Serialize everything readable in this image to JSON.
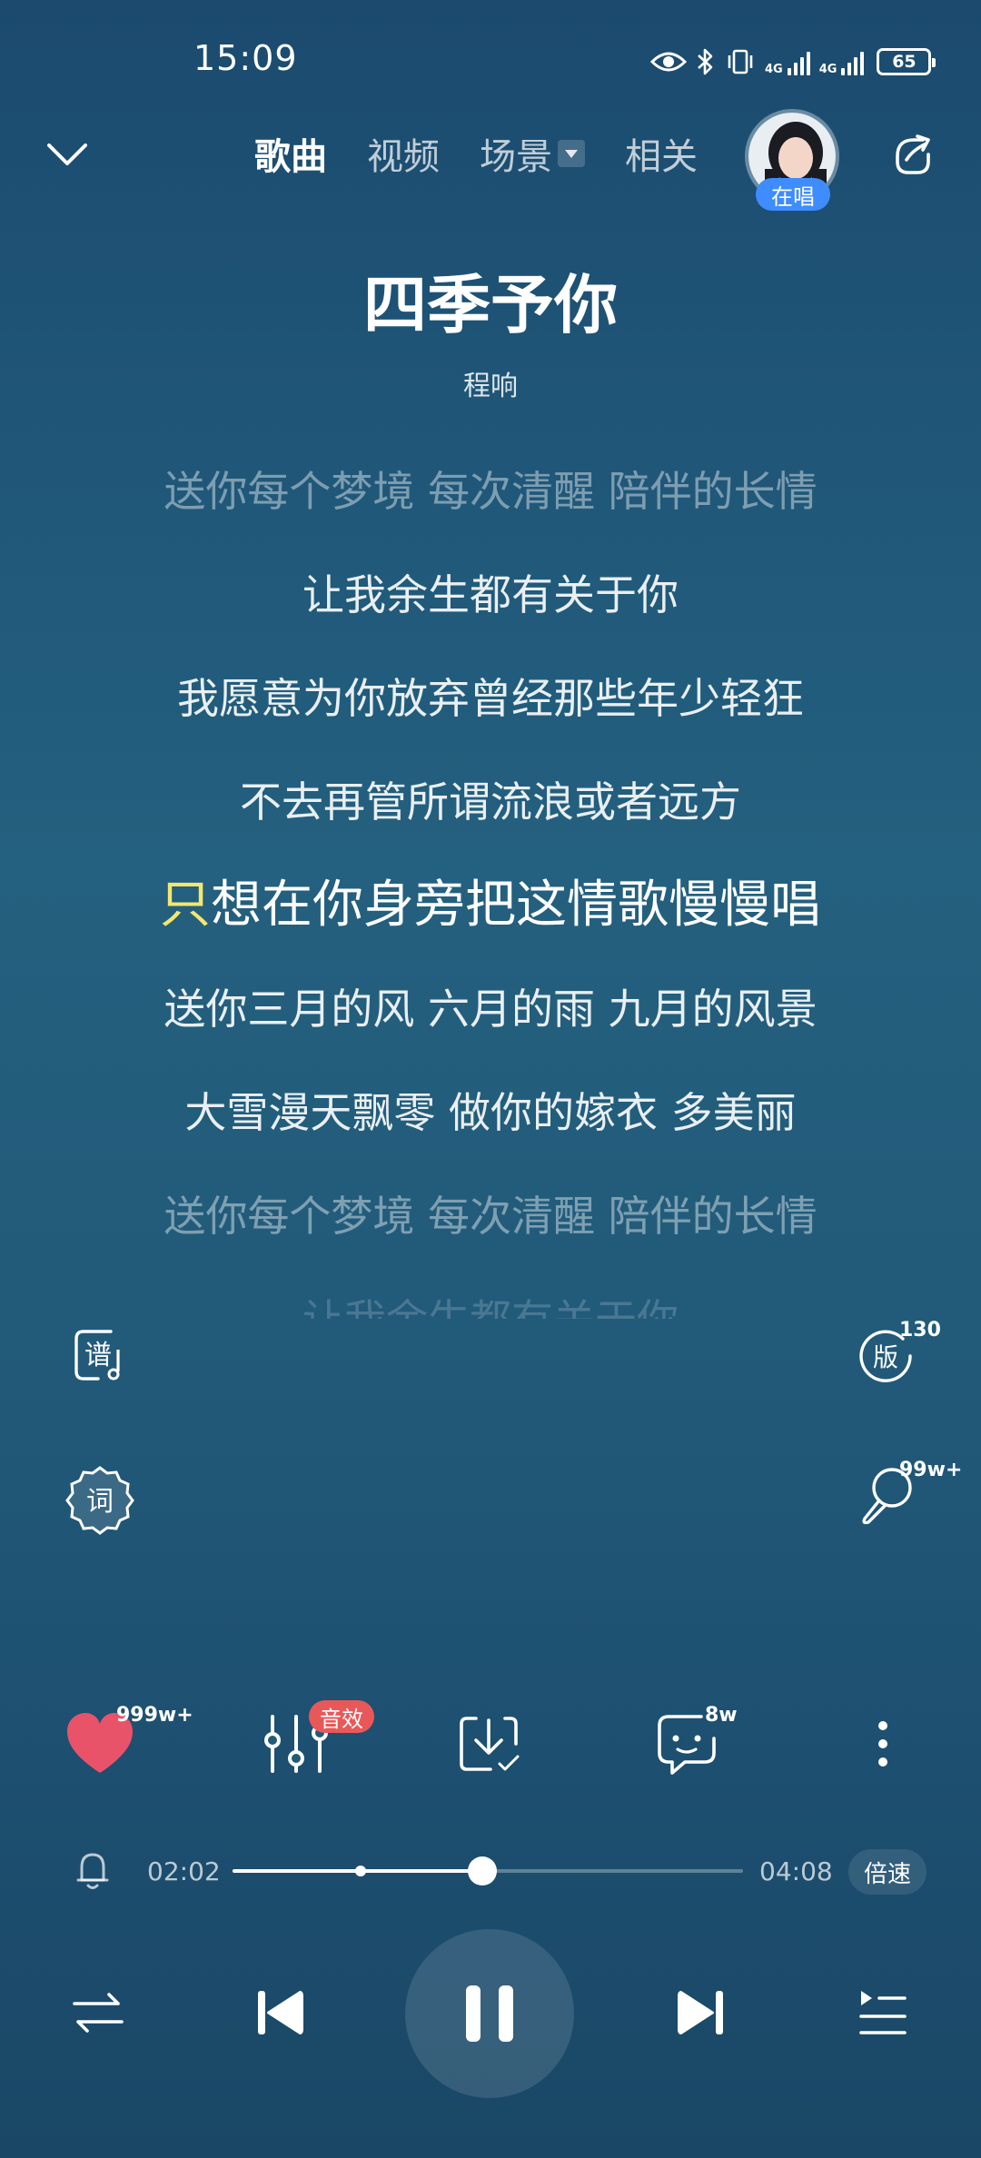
{
  "status_bar": {
    "time": "15:09",
    "network_1": "4G",
    "network_2": "4G",
    "battery": "65",
    "icons": [
      "eye-icon",
      "bluetooth-icon",
      "vibrate-icon",
      "signal-icon",
      "signal-icon",
      "battery-icon"
    ]
  },
  "nav": {
    "tabs": [
      {
        "label": "歌曲",
        "active": true
      },
      {
        "label": "视频",
        "active": false
      },
      {
        "label": "场景",
        "active": false
      },
      {
        "label": "相关",
        "active": false
      }
    ],
    "singing_badge": "在唱"
  },
  "song": {
    "title": "四季予你",
    "artist": "程响"
  },
  "lyrics": [
    {
      "text": "送你每个梦境 每次清醒 陪伴的长情",
      "state": "dim"
    },
    {
      "text": "让我余生都有关于你",
      "state": "normal"
    },
    {
      "text": "我愿意为你放弃曾经那些年少轻狂",
      "state": "normal"
    },
    {
      "text": "不去再管所谓流浪或者远方",
      "state": "normal"
    },
    {
      "text_first": "只",
      "text_rest": "想在你身旁把这情歌慢慢唱",
      "state": "current"
    },
    {
      "text": "送你三月的风 六月的雨 九月的风景",
      "state": "normal"
    },
    {
      "text": "大雪漫天飘零 做你的嫁衣 多美丽",
      "state": "normal"
    },
    {
      "text": "送你每个梦境 每次清醒 陪伴的长情",
      "state": "dim"
    },
    {
      "text": "让我余生都有关于你",
      "state": "faint"
    }
  ],
  "side": {
    "score_label": "谱",
    "lyrics_label": "词",
    "version_label": "版",
    "version_count": "130",
    "comment_bubble_count": "99w+"
  },
  "actions": {
    "like_count": "999w+",
    "sound_effect_badge": "音效",
    "comment_count": "8w"
  },
  "progress": {
    "current": "02:02",
    "total": "04:08",
    "fraction": 0.49,
    "marker_fraction": 0.25,
    "speed_label": "倍速"
  },
  "colors": {
    "accent_blue": "#3f8cff",
    "like_red": "#e8536a",
    "badge_red": "#e95858",
    "highlight_yellow": "#f5e66e"
  }
}
